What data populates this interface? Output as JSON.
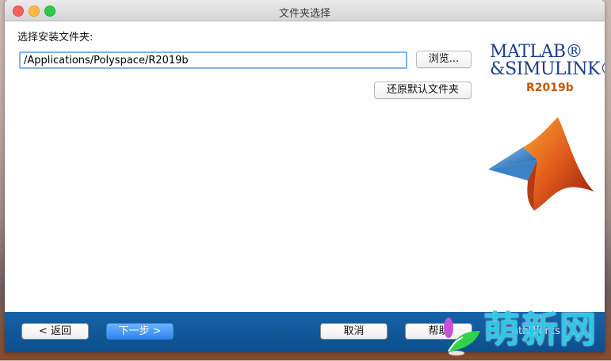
{
  "window": {
    "title": "文件夹选择"
  },
  "main": {
    "prompt_label": "选择安装文件夹:",
    "install_path": "/Applications/Polyspace/R2019b",
    "browse_label": "浏览...",
    "restore_default_label": "还原默认文件夹"
  },
  "logo": {
    "line1": "MATLAB®",
    "line2": "&SIMULINK®",
    "release": "R2019b"
  },
  "footer": {
    "back_label": "< 返回",
    "next_label": "下一步 >",
    "cancel_label": "取消",
    "help_label": "帮助",
    "vendor_partial": "athWorks"
  },
  "watermark": {
    "text": "萌新网"
  },
  "colors": {
    "footer_blue": "#1563a8",
    "primary_button": "#2b86f2",
    "logo_blue": "#1b3f8b",
    "logo_orange": "#c45a00",
    "watermark_cyan": "#2fc7e8"
  }
}
